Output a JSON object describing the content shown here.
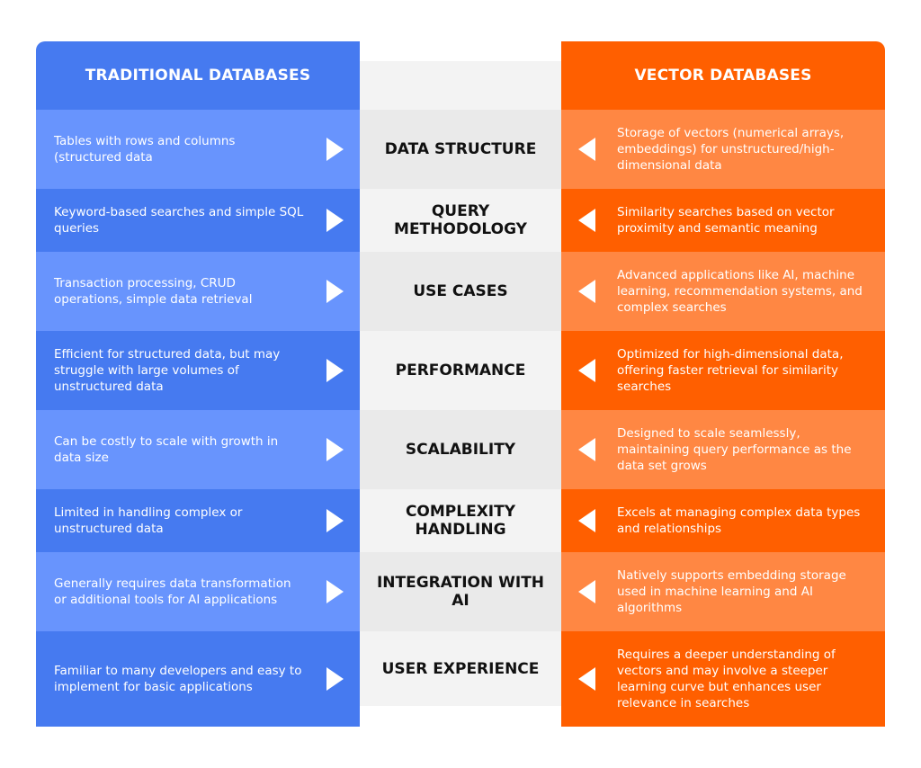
{
  "headers": {
    "left": "TRADITIONAL DATABASES",
    "right": "VECTOR DATABASES"
  },
  "colors": {
    "traditional_dark": "#467af0",
    "traditional_light": "#6894fd",
    "vector_dark": "#ff5f00",
    "vector_light": "#ff8743",
    "center_light": "#f3f3f3",
    "center_dark": "#eaeaea"
  },
  "rows": [
    {
      "criterion": "DATA STRUCTURE",
      "traditional": "Tables with rows and columns (structured data",
      "vector": "Storage of vectors (numerical arrays, embeddings) for unstructured/high-dimensional data"
    },
    {
      "criterion": "QUERY METHODOLOGY",
      "traditional": "Keyword-based searches and simple SQL queries",
      "vector": "Similarity searches based on vector proximity and semantic meaning"
    },
    {
      "criterion": "USE CASES",
      "traditional": "Transaction processing, CRUD operations, simple data retrieval",
      "vector": "Advanced applications like AI, machine learning, recommendation systems, and complex searches"
    },
    {
      "criterion": "PERFORMANCE",
      "traditional": "Efficient for structured data, but may struggle with large volumes of unstructured data",
      "vector": "Optimized for high-dimensional data, offering faster retrieval for similarity searches"
    },
    {
      "criterion": "SCALABILITY",
      "traditional": "Can be costly to scale with growth in data size",
      "vector": "Designed to scale seamlessly, maintaining query performance as the data set grows"
    },
    {
      "criterion": "COMPLEXITY HANDLING",
      "traditional": "Limited in handling complex or unstructured data",
      "vector": "Excels at managing complex data types and relationships"
    },
    {
      "criterion": "INTEGRATION WITH AI",
      "traditional": "Generally requires data transformation or additional tools for AI applications",
      "vector": "Natively supports embedding storage used in machine learning and AI algorithms"
    },
    {
      "criterion": "USER EXPERIENCE",
      "traditional": "Familiar to many developers and easy to implement for basic applications",
      "vector": "Requires a deeper understanding of vectors and may involve a steeper learning curve but enhances user relevance in searches"
    }
  ]
}
